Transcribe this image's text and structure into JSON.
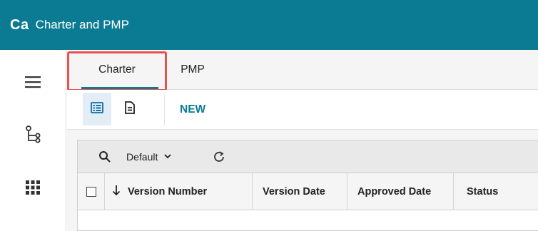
{
  "header": {
    "app_code": "Ca",
    "title": "Charter and PMP",
    "background_color": "#0b7b94"
  },
  "rail": {
    "items": [
      {
        "icon": "hamburger-menu-icon"
      },
      {
        "icon": "hierarchy-tree-icon"
      },
      {
        "icon": "apps-grid-icon"
      }
    ]
  },
  "tabs": {
    "items": [
      {
        "label": "Charter",
        "selected": true
      },
      {
        "label": "PMP",
        "selected": false
      }
    ],
    "highlight_color": "#e2544f"
  },
  "toolbar": {
    "list_view_icon": "list-view-icon",
    "document_view_icon": "document-icon",
    "new_label": "NEW"
  },
  "grid": {
    "view_selector": "Default",
    "columns": [
      {
        "label": "Version Number",
        "sorted": "descending"
      },
      {
        "label": "Version Date"
      },
      {
        "label": "Approved Date"
      },
      {
        "label": "Status"
      }
    ]
  }
}
